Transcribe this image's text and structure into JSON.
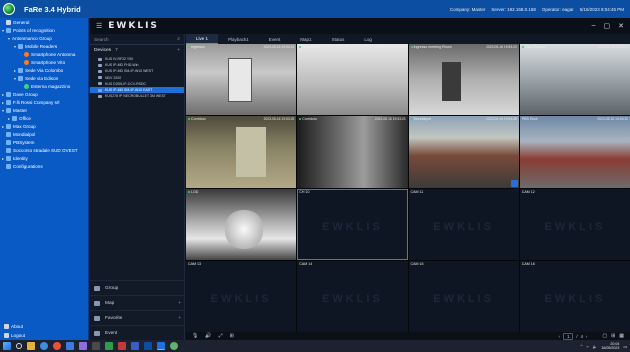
{
  "app": {
    "title": "FaRe 3.4 Hybrid",
    "company": "Company: Master",
    "server": "Server: 192.168.0.168",
    "operator": "Operator: eagar",
    "datetime": "5/16/2023 8:04:45 PM"
  },
  "nav": {
    "items": [
      {
        "label": "General",
        "indent": 0,
        "exp": "",
        "ico": "gray",
        "icon_name": "settings-icon"
      },
      {
        "label": "Points of recognition",
        "indent": 0,
        "exp": "▾",
        "ico": "blue",
        "icon_name": "map-pin-icon"
      },
      {
        "label": "Antonmanco Group",
        "indent": 1,
        "exp": "▾",
        "ico": "",
        "icon_name": ""
      },
      {
        "label": "Mobile Readers",
        "indent": 2,
        "exp": "▾",
        "ico": "blue",
        "icon_name": "folder-icon"
      },
      {
        "label": "Smartphone Antonma",
        "indent": 3,
        "exp": "",
        "ico": "orange",
        "icon_name": "phone-icon"
      },
      {
        "label": "Smartphone Vito",
        "indent": 3,
        "exp": "",
        "ico": "orange",
        "icon_name": "phone-icon"
      },
      {
        "label": "Sede Via Colombo",
        "indent": 2,
        "exp": "▸",
        "ico": "blue",
        "icon_name": "folder-icon"
      },
      {
        "label": "Sede via Edison",
        "indent": 2,
        "exp": "▾",
        "ico": "blue",
        "icon_name": "folder-icon"
      },
      {
        "label": "Esterna magazzino",
        "indent": 3,
        "exp": "",
        "ico": "green",
        "icon_name": "camera-icon"
      },
      {
        "label": "Dave Group",
        "indent": 0,
        "exp": "▸",
        "ico": "blue",
        "icon_name": "folder-icon"
      },
      {
        "label": "F.lli Rossi Company srl",
        "indent": 0,
        "exp": "▸",
        "ico": "blue",
        "icon_name": "folder-icon"
      },
      {
        "label": "Master",
        "indent": 0,
        "exp": "▾",
        "ico": "blue",
        "icon_name": "folder-icon"
      },
      {
        "label": "Office",
        "indent": 1,
        "exp": "▸",
        "ico": "blue",
        "icon_name": "folder-icon"
      },
      {
        "label": "Max Group",
        "indent": 0,
        "exp": "▸",
        "ico": "blue",
        "icon_name": "folder-icon"
      },
      {
        "label": "Mondialpol",
        "indent": 0,
        "exp": "",
        "ico": "blue",
        "icon_name": "folder-icon"
      },
      {
        "label": "PBSystem",
        "indent": 0,
        "exp": "",
        "ico": "blue",
        "icon_name": "folder-icon"
      },
      {
        "label": "Soccorso stradale SUD OVEST",
        "indent": 0,
        "exp": "",
        "ico": "blue",
        "icon_name": "folder-icon"
      },
      {
        "label": "Identity",
        "indent": 0,
        "exp": "▸",
        "ico": "blue",
        "icon_name": "user-icon"
      },
      {
        "label": "Configurations",
        "indent": 0,
        "exp": "",
        "ico": "blue",
        "icon_name": "gear-icon"
      }
    ],
    "bottom": [
      {
        "label": "About",
        "icon_name": "info-icon"
      },
      {
        "label": "Logout",
        "icon_name": "logout-icon"
      }
    ]
  },
  "client": {
    "brand": "EWKLIS",
    "search_placeholder": "Search",
    "devices_label": "Devices",
    "devices_count": "7",
    "devices": [
      {
        "label": "KUS IV-RF22 Y50",
        "selected": false
      },
      {
        "label": "KUS IP-MD FHD-Win",
        "selected": false
      },
      {
        "label": "KUS IP-MD SM-IP-W10 WEST",
        "selected": false
      },
      {
        "label": "NDV 2200",
        "selected": false
      },
      {
        "label": "KUS D2D5-IP-CCV-RSDC",
        "selected": false
      },
      {
        "label": "KUS IP-MD SM-IP-W10 EAST",
        "selected": true
      },
      {
        "label": "KUS278 IP NECROBULLET 3M WEST",
        "selected": false
      }
    ],
    "bottom_items": [
      {
        "label": "Group",
        "plus": false
      },
      {
        "label": "Map",
        "plus": true
      },
      {
        "label": "Favorite",
        "plus": true
      },
      {
        "label": "Event",
        "plus": false
      }
    ],
    "tabs": [
      {
        "label": "Live 1",
        "active": true
      },
      {
        "label": "Playback1",
        "active": false
      },
      {
        "label": "Event",
        "active": false
      },
      {
        "label": "Map1",
        "active": false
      },
      {
        "label": "Status",
        "active": false
      },
      {
        "label": "Log",
        "active": false
      }
    ],
    "watermark": "EWKLIS",
    "cameras": [
      {
        "label": "Ingresso",
        "ts": "2023-05-16 19:53:23",
        "feed": "f1",
        "live": true
      },
      {
        "label": "Tornelletto",
        "ts": "2023-05-16 19:53:23",
        "feed": "f2",
        "live": true
      },
      {
        "label": "Ingresso meeting Room",
        "ts": "2023-05-16 19:53:23",
        "feed": "f3",
        "live": true
      },
      {
        "label": "Sala Riunioni",
        "ts": "2023-05-16 19:53:23",
        "feed": "f4",
        "live": true
      },
      {
        "label": "Corridoio",
        "ts": "2023-05-16 19:53:25",
        "feed": "f5",
        "live": true
      },
      {
        "label": "Corridoio",
        "ts": "2023-05-16 19:53:23",
        "feed": "f6",
        "live": true
      },
      {
        "label": "Mondialpol",
        "ts": "2023-05-16 19:53:45",
        "feed": "f7",
        "live": true,
        "badge": true
      },
      {
        "label": "PBS Roof",
        "ts": "2023-05-16 19:53:23",
        "feed": "f8",
        "live": false
      },
      {
        "label": "LOD",
        "ts": "",
        "feed": "f9",
        "live": true
      },
      {
        "label": "CH 10",
        "ts": "",
        "feed": "",
        "live": false,
        "selected": true
      },
      {
        "label": "CAM 11",
        "ts": "",
        "feed": "",
        "live": false
      },
      {
        "label": "CAM 12",
        "ts": "",
        "feed": "",
        "live": false
      },
      {
        "label": "CAM 13",
        "ts": "",
        "feed": "",
        "live": false
      },
      {
        "label": "CAM 14",
        "ts": "",
        "feed": "",
        "live": false
      },
      {
        "label": "CAM 15",
        "ts": "",
        "feed": "",
        "live": false
      },
      {
        "label": "CAM 16",
        "ts": "",
        "feed": "",
        "live": false
      }
    ],
    "pager": {
      "current": "1",
      "separator": "/",
      "total": "4"
    }
  },
  "taskbar": {
    "time": "20:04",
    "date": "16/05/2023"
  },
  "colors": {
    "appbar": "#0b4ea2",
    "nav": "#0a5ac6",
    "client_bg": "#0d1522",
    "accent": "#2f7cf0"
  }
}
